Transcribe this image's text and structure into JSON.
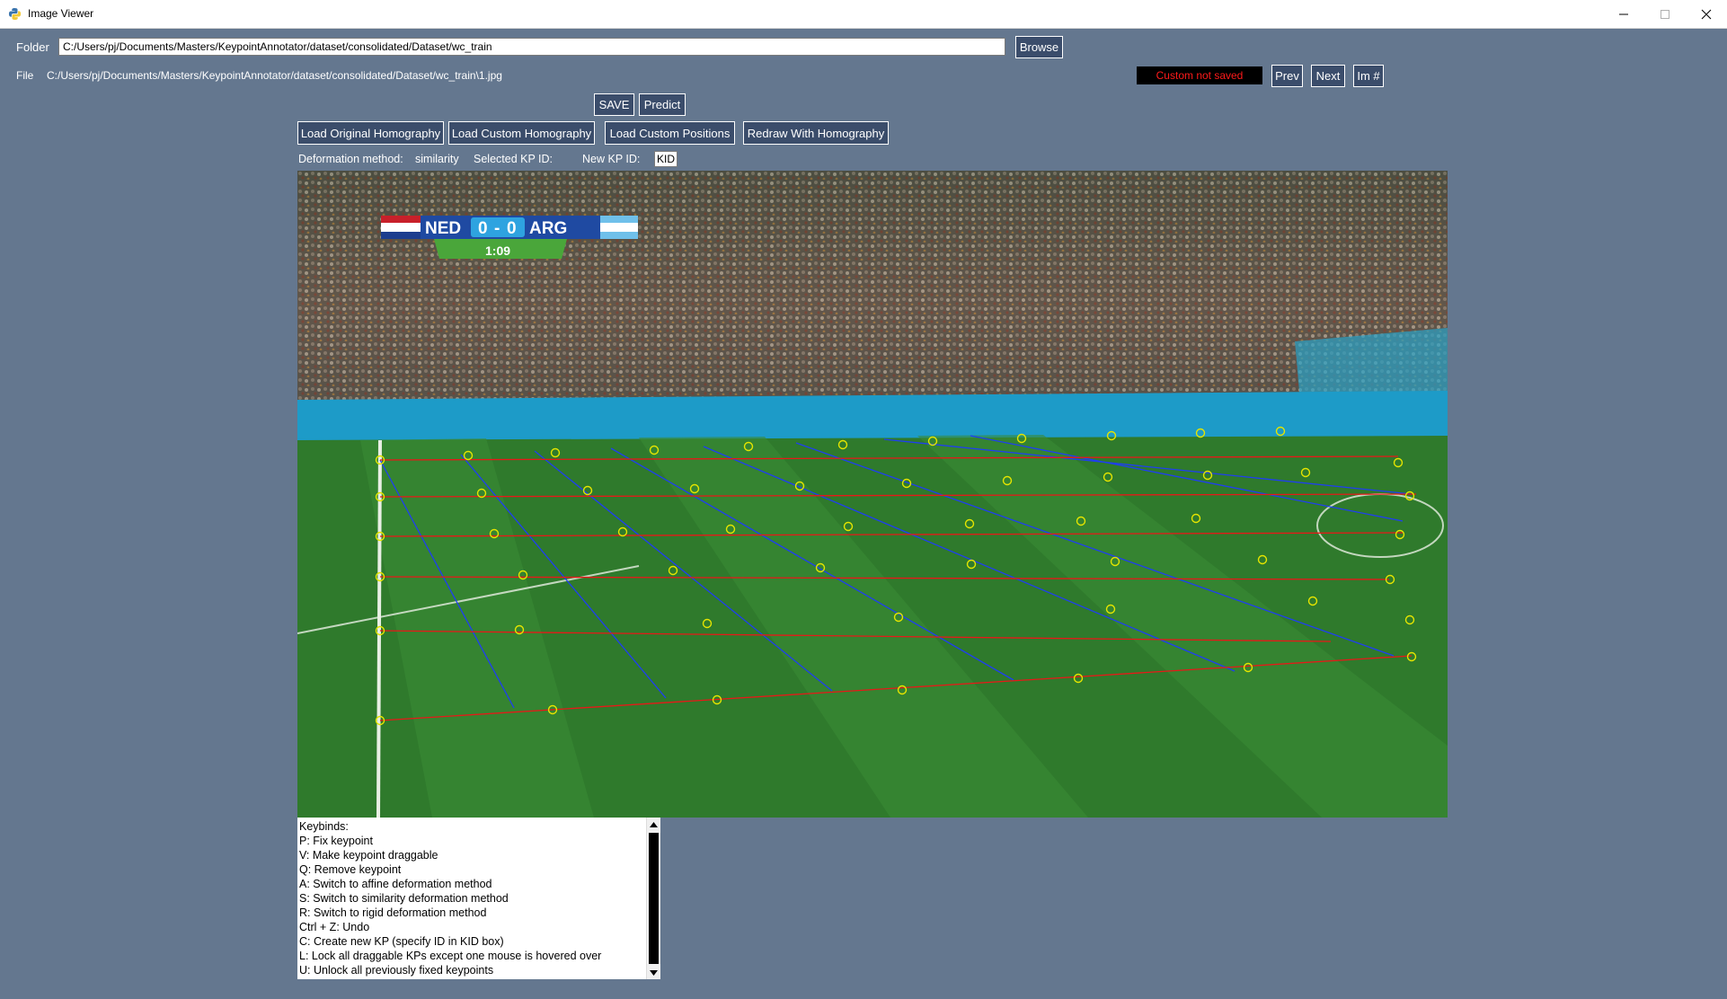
{
  "window": {
    "title": "Image Viewer"
  },
  "folder": {
    "label": "Folder",
    "value": "C:/Users/pj/Documents/Masters/KeypointAnnotator/dataset/consolidated/Dataset/wc_train",
    "browse_label": "Browse"
  },
  "file": {
    "label": "File",
    "path": "C:/Users/pj/Documents/Masters/KeypointAnnotator/dataset/consolidated/Dataset/wc_train\\1.jpg"
  },
  "status": {
    "text": "Custom not saved",
    "color": "#ff1a1a"
  },
  "nav": {
    "prev_label": "Prev",
    "next_label": "Next",
    "imnum_label": "Im #"
  },
  "actions": {
    "save_label": "SAVE",
    "predict_label": "Predict",
    "load_original_label": "Load Original Homography",
    "load_custom_label": "Load Custom Homography",
    "load_positions_label": "Load Custom Positions",
    "redraw_label": "Redraw With Homography"
  },
  "info": {
    "deformation_label": "Deformation method:",
    "deformation_value": "similarity",
    "selected_kp_label": "Selected KP ID:",
    "selected_kp_value": "",
    "new_kp_label": "New KP ID:",
    "new_kp_value": "KID"
  },
  "scoreboard": {
    "home": "NED",
    "away": "ARG",
    "home_score": "0",
    "away_score": "0",
    "separator": "-",
    "clock": "1:09"
  },
  "overlay": {
    "keypoint_color": "#e5e500",
    "vertical_line_color": "#1f3ef2",
    "horizontal_line_color": "#e81818"
  },
  "keybinds": {
    "lines": [
      "Keybinds:",
      "P: Fix keypoint",
      "V: Make keypoint draggable",
      "Q: Remove keypoint",
      "A: Switch to affine deformation method",
      "S: Switch to similarity deformation method",
      "R: Switch to rigid deformation method",
      "Ctrl + Z: Undo",
      "C: Create new KP (specify ID in KID box)",
      "L: Lock all draggable KPs except one mouse is hovered over",
      "U: Unlock all previously fixed keypoints"
    ]
  },
  "colors": {
    "background": "#64778f",
    "button_bg": "#3b4d6b",
    "pitch": "#2f7a2c"
  }
}
